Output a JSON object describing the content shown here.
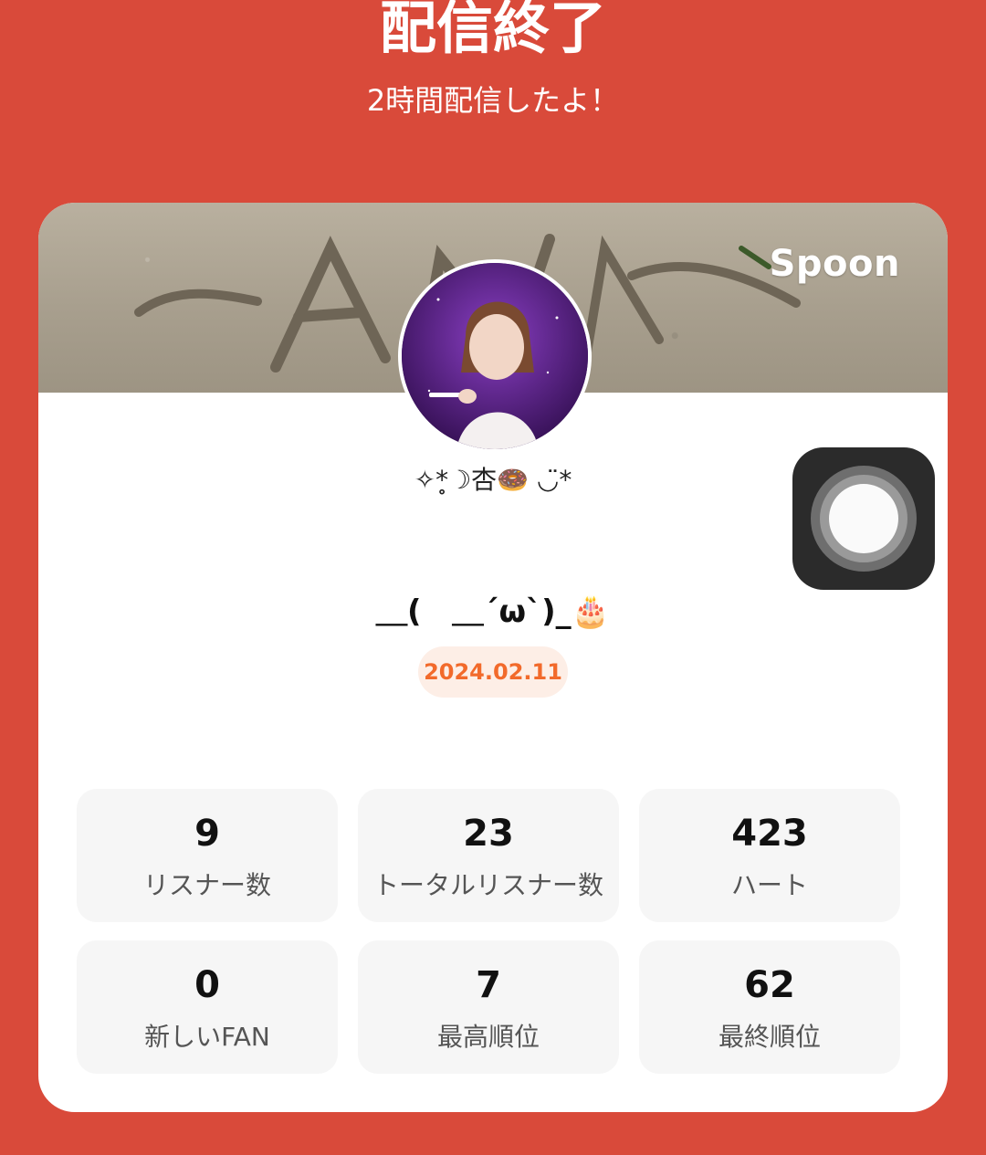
{
  "header": {
    "title": "配信終了",
    "subtitle": "2時間配信したよ！"
  },
  "card": {
    "brand": "Spoon",
    "nickname": "✧*̥☽杏🍩 ◡̈*",
    "broadcast_title": "＿(　＿´ω`)_🎂",
    "date": "2024.02.11",
    "stats": [
      {
        "value": "9",
        "label": "リスナー数"
      },
      {
        "value": "23",
        "label": "トータルリスナー数"
      },
      {
        "value": "423",
        "label": "ハート"
      },
      {
        "value": "0",
        "label": "新しいFAN"
      },
      {
        "value": "7",
        "label": "最高順位"
      },
      {
        "value": "62",
        "label": "最終順位"
      }
    ]
  },
  "colors": {
    "background": "#d94a3a",
    "card": "#ffffff",
    "date_text": "#f26a2b",
    "date_badge": "#fdeee6",
    "stat_tile": "#f6f6f6"
  },
  "icons": {
    "assistive_touch": "assistive-touch-icon"
  }
}
